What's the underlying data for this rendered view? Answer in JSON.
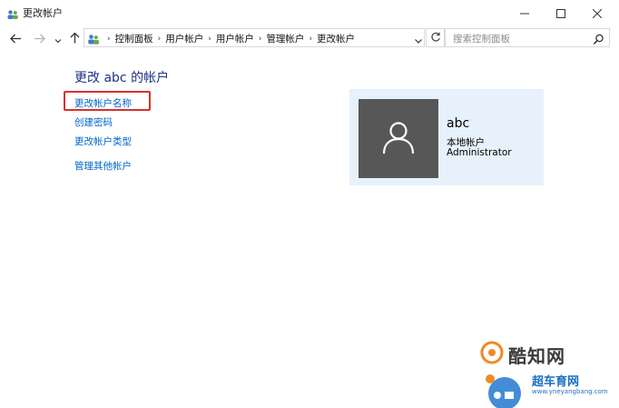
{
  "window": {
    "title": "更改帐户",
    "controls": {
      "minimize_icon": "minimize-icon",
      "maximize_icon": "maximize-icon",
      "close_icon": "close-icon"
    }
  },
  "navigation": {
    "back_icon": "arrow-left-icon",
    "forward_icon": "arrow-right-icon",
    "recent_icon": "chevron-down-icon",
    "up_icon": "arrow-up-icon",
    "breadcrumb": [
      "控制面板",
      "用户帐户",
      "用户帐户",
      "管理帐户",
      "更改帐户"
    ],
    "refresh_icon": "refresh-icon",
    "search": {
      "placeholder": "搜索控制面板",
      "icon": "search-icon"
    }
  },
  "content": {
    "heading": "更改 abc 的帐户",
    "links": {
      "rename": "更改帐户名称",
      "password": "创建密码",
      "account_type": "更改帐户类型",
      "manage_other": "管理其他帐户"
    },
    "highlighted_link": "rename",
    "highlight_color": "#d9302c"
  },
  "user_card": {
    "name": "abc",
    "account_kind": "本地帐户",
    "role": "Administrator",
    "avatar_icon": "user-silhouette-icon",
    "background": "#e6f1fb"
  },
  "watermarks": {
    "brand1": "酷知网",
    "brand2": "超车育网",
    "brand2_url": "www.yneyangbang.com"
  }
}
